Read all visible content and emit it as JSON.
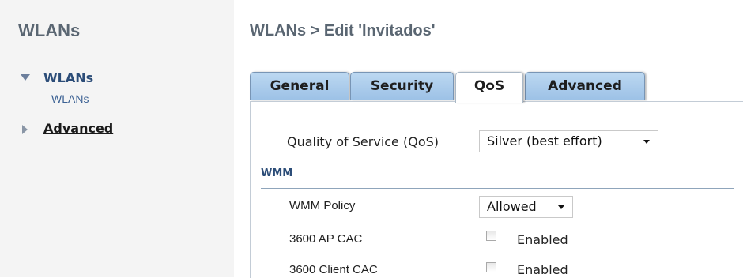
{
  "sidebar": {
    "title": "WLANs",
    "groups": [
      {
        "label": "WLANs",
        "expanded": true,
        "icon": "triangle-down-icon",
        "children": [
          "WLANs"
        ]
      },
      {
        "label": "Advanced",
        "expanded": false,
        "icon": "triangle-right-icon"
      }
    ]
  },
  "header": {
    "title": "WLANs > Edit  'Invitados'"
  },
  "tabs": [
    {
      "label": "General",
      "active": false
    },
    {
      "label": "Security",
      "active": false
    },
    {
      "label": "QoS",
      "active": true
    },
    {
      "label": "Advanced",
      "active": false
    }
  ],
  "qos": {
    "label": "Quality of Service (QoS)",
    "value": "Silver (best effort)"
  },
  "wmm": {
    "heading": "WMM",
    "policy_label": "WMM Policy",
    "policy_value": "Allowed",
    "ap_cac_label": "3600 AP CAC",
    "ap_cac_checkbox_label": "Enabled",
    "ap_cac_checked": false,
    "client_cac_label": "3600 Client CAC",
    "client_cac_checkbox_label": "Enabled",
    "client_cac_checked": false
  },
  "colors": {
    "tab_blue": "#9cc1e6",
    "nav_text": "#2c4d78",
    "title_gray": "#5a6672"
  }
}
